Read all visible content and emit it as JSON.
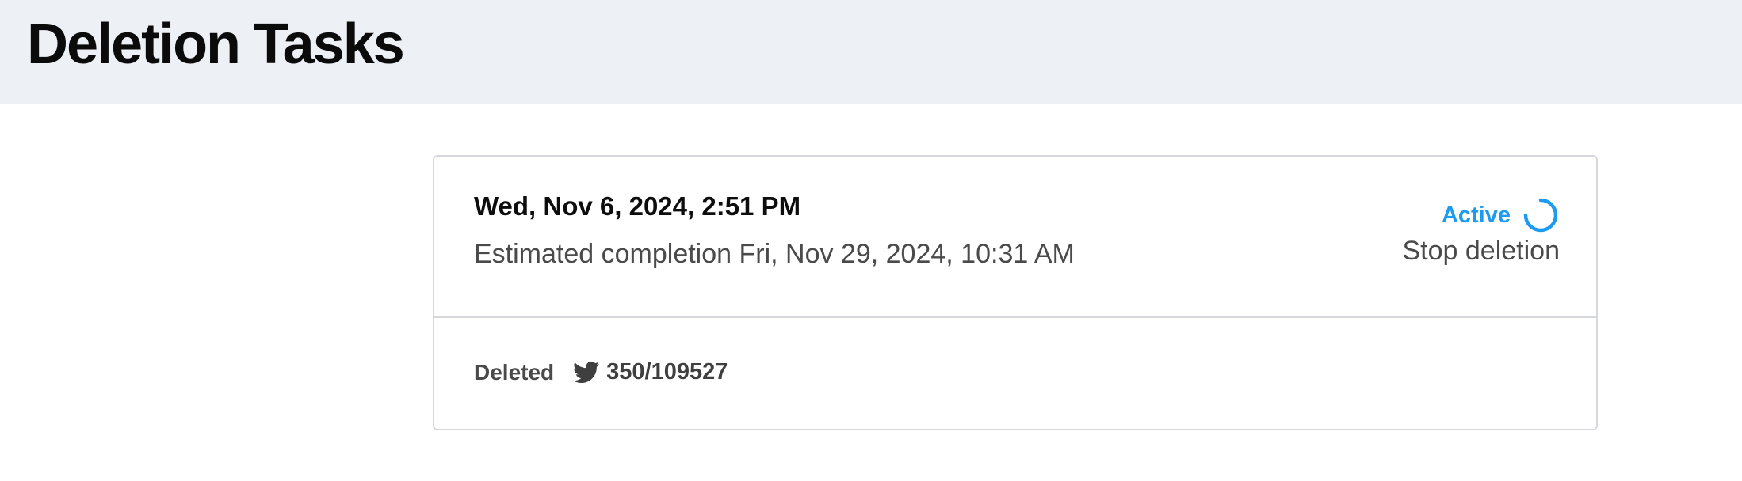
{
  "header": {
    "title": "Deletion Tasks"
  },
  "task": {
    "started": "Wed, Nov 6, 2024, 2:51 PM",
    "estimate": "Estimated completion Fri, Nov 29, 2024, 10:31 AM",
    "status": "Active",
    "status_color": "#1d9bf0",
    "stop_label": "Stop deletion",
    "deleted_label": "Deleted",
    "platform_icon": "twitter-icon",
    "deleted_count": "350/109527"
  }
}
